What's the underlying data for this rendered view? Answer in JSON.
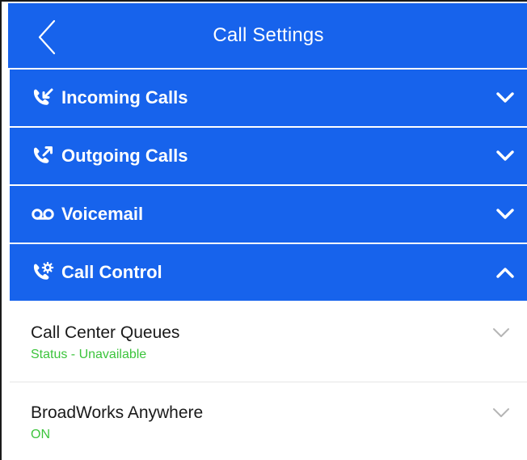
{
  "header": {
    "title": "Call Settings",
    "back_icon": "chevron-left-icon"
  },
  "sections": [
    {
      "label": "Incoming Calls",
      "icon": "incoming-call-icon",
      "expanded": false
    },
    {
      "label": "Outgoing Calls",
      "icon": "outgoing-call-icon",
      "expanded": false
    },
    {
      "label": "Voicemail",
      "icon": "voicemail-icon",
      "expanded": false
    },
    {
      "label": "Call Control",
      "icon": "call-control-icon",
      "expanded": true
    }
  ],
  "call_control_items": [
    {
      "title": "Call Center Queues",
      "status": "Status - Unavailable"
    },
    {
      "title": "BroadWorks Anywhere",
      "status": "ON"
    }
  ],
  "colors": {
    "primary": "#1763ec",
    "header_text": "#ffffff",
    "status_green": "#3cc43c",
    "chevron_gray": "#b5b5b5",
    "divider": "#e6e6e6"
  }
}
